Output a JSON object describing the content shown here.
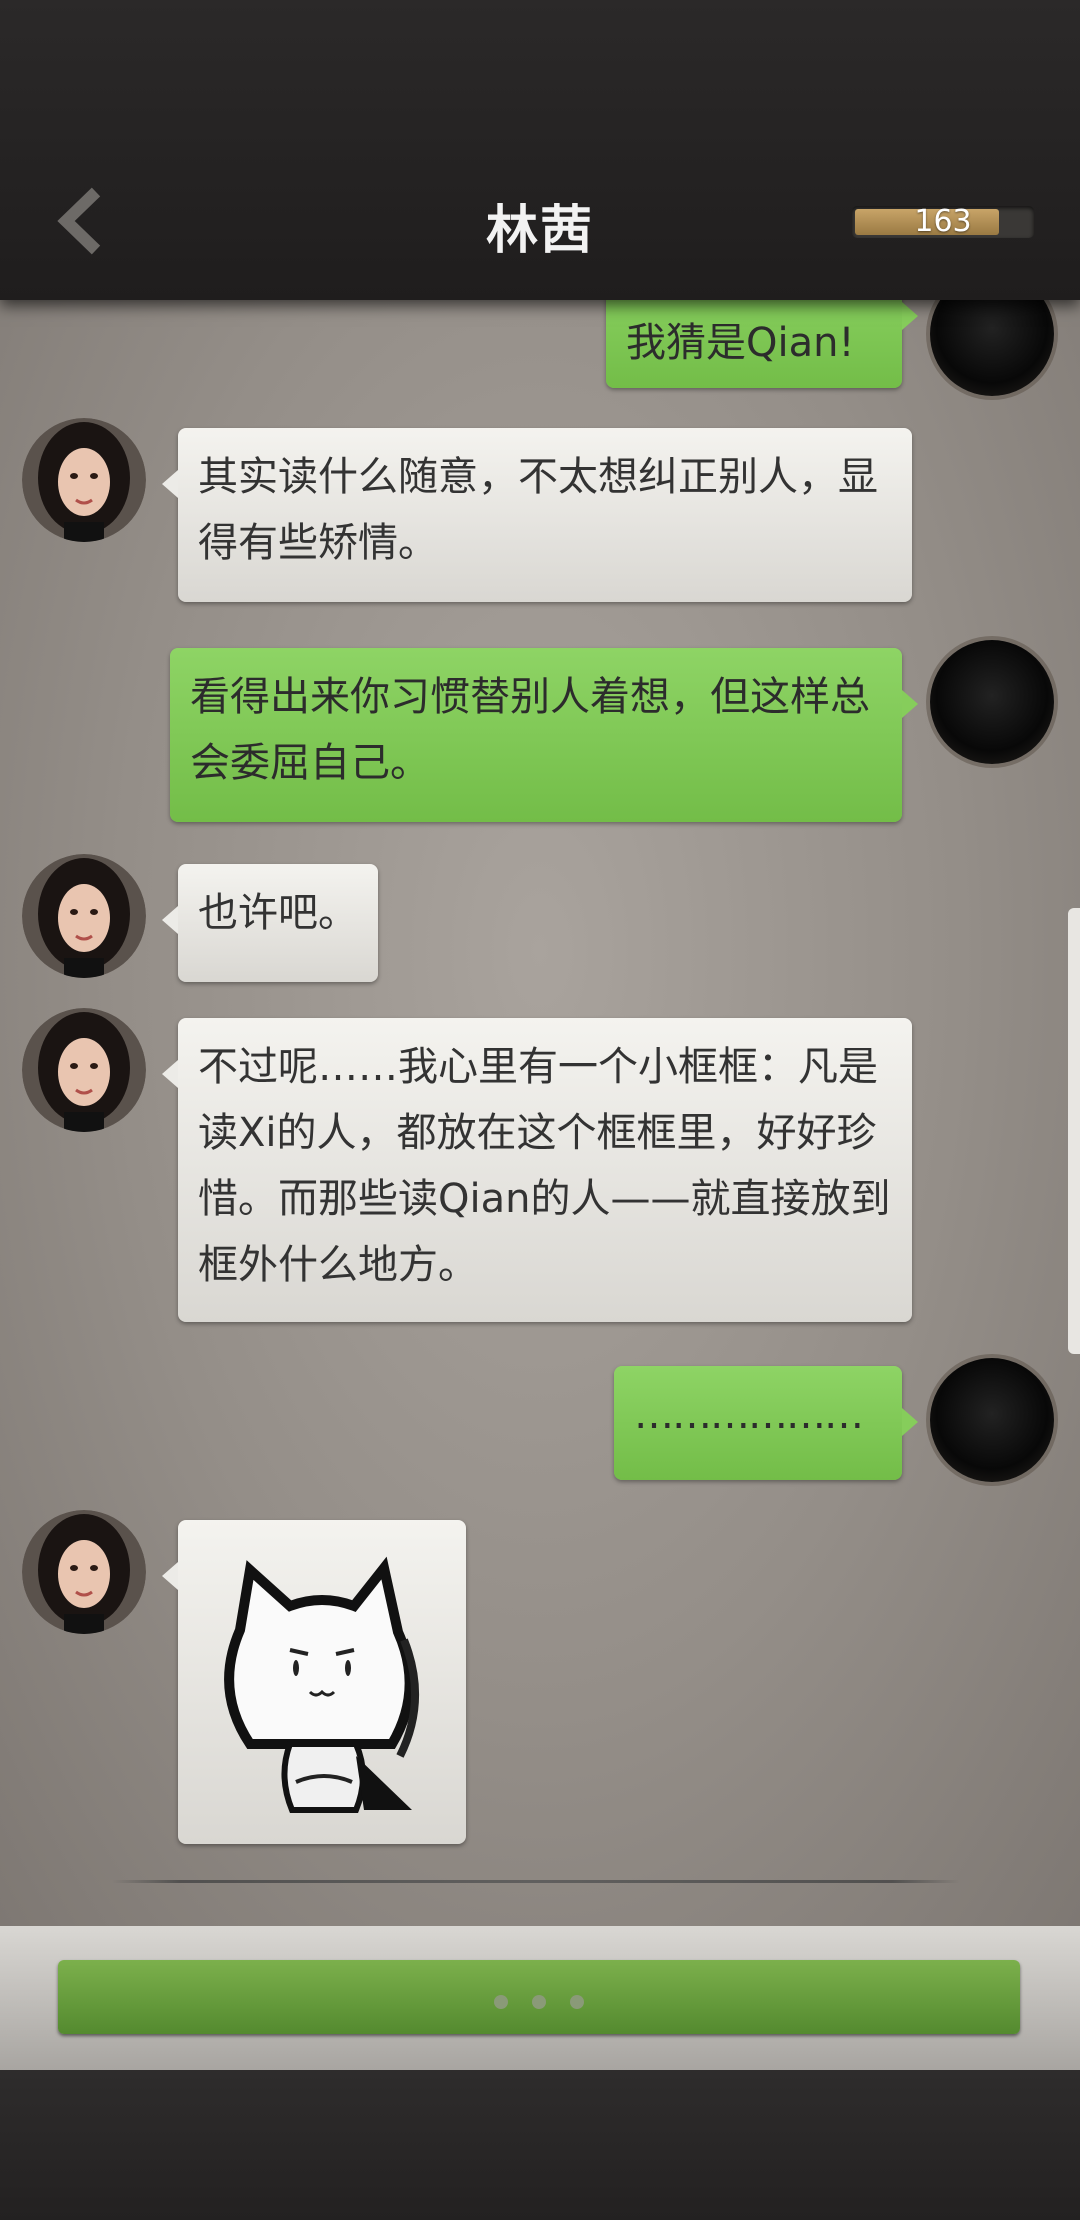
{
  "header": {
    "back_icon": "chevron-left-icon",
    "title": "林茜",
    "progress": {
      "value": "163",
      "fill_fraction": 0.8
    }
  },
  "messages": [
    {
      "from": "self",
      "text": "我猜是Qian!"
    },
    {
      "from": "contact",
      "text": "其实读什么随意，不太想纠正别人，显得有些矫情。"
    },
    {
      "from": "self",
      "text": "看得出来你习惯替别人着想，但这样总会委屈自己。"
    },
    {
      "from": "contact",
      "text": "也许吧。"
    },
    {
      "from": "contact",
      "text": "不过呢……我心里有一个小框框：凡是读Xi的人，都放在这个框框里，好好珍惜。而那些读Qian的人——就直接放到框外什么地方。"
    },
    {
      "from": "self",
      "text": "………………"
    },
    {
      "from": "contact",
      "sticker": "cat-sticker-icon"
    }
  ],
  "bottom": {
    "continue_button": "typing-indicator"
  },
  "colors": {
    "mine_bubble": "#86cd5b",
    "other_bubble": "#ecebe7",
    "header": "#252323",
    "button": "#6a9e3f"
  }
}
